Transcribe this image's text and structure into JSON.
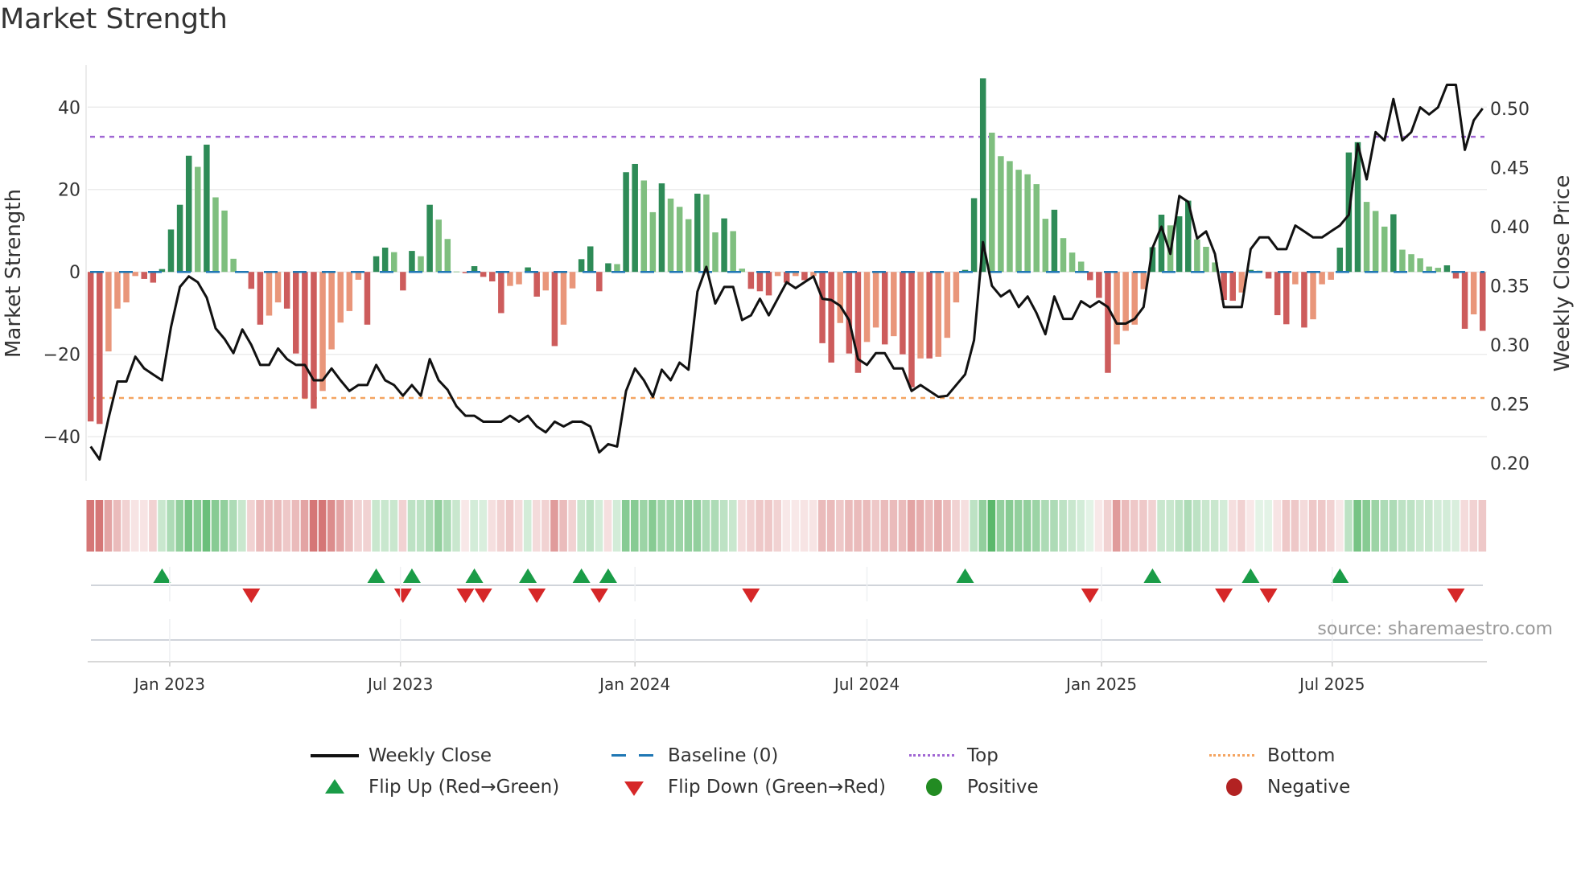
{
  "title": "Market Strength",
  "source": "source: sharemaestro.com",
  "legend": {
    "weekly_close": "Weekly Close",
    "baseline": "Baseline (0)",
    "top": "Top",
    "bottom": "Bottom",
    "flip_up": "Flip Up (Red→Green)",
    "flip_down": "Flip Down (Green→Red)",
    "positive": "Positive",
    "negative": "Negative"
  },
  "colors": {
    "pos_strong": "#2e8b57",
    "pos_weak": "#7fbf7f",
    "neg_strong": "#cd5c5c",
    "neg_weak": "#e9967a",
    "baseline": "#1f77b4",
    "top": "#a066d3",
    "bottom": "#f4a460",
    "line": "#111111",
    "flip_up": "#1a9c47",
    "flip_down": "#d62728",
    "positive": "#228b22",
    "negative": "#b22222"
  },
  "chart_data": {
    "type": "bar",
    "title": "Market Strength",
    "ylabel": "Market Strength",
    "ylabel_right": "Weekly Close Price",
    "frequency": "weekly",
    "start_date": "2022-10-31",
    "ylim": [
      -50.7,
      50.2
    ],
    "ylim_right": [
      0.185,
      0.5367
    ],
    "yticks": [
      40,
      20,
      0,
      -20,
      -40
    ],
    "yticks_labels": [
      "40",
      "20",
      "0",
      "−20",
      "−40"
    ],
    "yticks_right": [
      0.5,
      0.45,
      0.4,
      0.35,
      0.3,
      0.25,
      0.2
    ],
    "yticks_right_labels": [
      "0.50",
      "0.45",
      "0.40",
      "0.35",
      "0.30",
      "0.25",
      "0.20"
    ],
    "xticks": [
      {
        "date": "2023-01-01",
        "label": "Jan 2023"
      },
      {
        "date": "2023-07-01",
        "label": "Jul 2023"
      },
      {
        "date": "2024-01-01",
        "label": "Jan 2024"
      },
      {
        "date": "2024-07-01",
        "label": "Jul 2024"
      },
      {
        "date": "2025-01-01",
        "label": "Jan 2025"
      },
      {
        "date": "2025-07-01",
        "label": "Jul 2025"
      }
    ],
    "top_level": 32.8,
    "bottom_level": -30.6,
    "baseline": 0,
    "strength": [
      -36.3,
      -36.9,
      -19.3,
      -8.9,
      -7.4,
      -1,
      -1.7,
      -2.6,
      0.7,
      10.3,
      16.3,
      28.2,
      25.5,
      30.9,
      18.1,
      14.9,
      3.2,
      0.2,
      -4.1,
      -12.8,
      -10.6,
      -7.4,
      -8.9,
      -19.8,
      -30.7,
      -33.2,
      -28.9,
      -18.8,
      -12.3,
      -9.5,
      -1.9,
      -12.8,
      3.8,
      5.9,
      4.8,
      -4.5,
      5.1,
      3.8,
      16.3,
      12.7,
      8,
      0.1,
      -0.3,
      1.4,
      -1.2,
      -2.3,
      -10,
      -3.4,
      -3,
      1.1,
      -6,
      -4.5,
      -18,
      -12.8,
      -4,
      3.1,
      6.2,
      -4.7,
      2.1,
      1.9,
      24.2,
      26.2,
      22.2,
      14.5,
      21.5,
      17.8,
      15.8,
      12.8,
      19,
      18.8,
      9.6,
      13,
      9.9,
      0.8,
      -4.1,
      -4.7,
      -5.7,
      -1,
      -2.6,
      -1,
      -2,
      -1,
      -17.3,
      -22,
      -12.4,
      -19.8,
      -24.5,
      -17,
      -13.5,
      -17.6,
      -15.6,
      -20,
      -28,
      -21,
      -21,
      -20.6,
      -16,
      -7.4,
      0.5,
      17.9,
      47,
      33.8,
      28.1,
      26.9,
      24.8,
      23.7,
      21.3,
      12.9,
      15.1,
      8.2,
      4.7,
      2.5,
      -2,
      -6.3,
      -24.5,
      -17.6,
      -14.3,
      -12.8,
      -4.2,
      6,
      13.9,
      11.3,
      13.5,
      17.3,
      7.9,
      6.1,
      2.3,
      -6.8,
      -7,
      -5,
      0.5,
      0.3,
      -1.6,
      -10.5,
      -12.7,
      -3,
      -13.5,
      -11.5,
      -3,
      -1.9,
      5.9,
      29,
      31.5,
      17,
      14.8,
      11,
      14,
      5.4,
      4.3,
      3.3,
      1.3,
      1,
      1.6,
      -1.6,
      -13.8,
      -10.3,
      -14.3
    ],
    "weekly_close": [
      0.214,
      0.203,
      0.238,
      0.269,
      0.269,
      0.29,
      0.28,
      0.275,
      0.27,
      0.315,
      0.349,
      0.358,
      0.353,
      0.34,
      0.314,
      0.305,
      0.293,
      0.313,
      0.3,
      0.283,
      0.283,
      0.297,
      0.288,
      0.283,
      0.283,
      0.27,
      0.27,
      0.28,
      0.27,
      0.261,
      0.266,
      0.266,
      0.283,
      0.27,
      0.266,
      0.257,
      0.266,
      0.257,
      0.288,
      0.27,
      0.262,
      0.248,
      0.24,
      0.24,
      0.235,
      0.235,
      0.235,
      0.24,
      0.235,
      0.24,
      0.231,
      0.226,
      0.235,
      0.231,
      0.235,
      0.235,
      0.231,
      0.209,
      0.216,
      0.214,
      0.261,
      0.28,
      0.27,
      0.256,
      0.279,
      0.27,
      0.285,
      0.279,
      0.345,
      0.366,
      0.335,
      0.349,
      0.349,
      0.321,
      0.325,
      0.339,
      0.325,
      0.339,
      0.353,
      0.348,
      0.353,
      0.358,
      0.339,
      0.338,
      0.333,
      0.321,
      0.288,
      0.283,
      0.293,
      0.293,
      0.28,
      0.28,
      0.261,
      0.266,
      0.261,
      0.256,
      0.257,
      0.266,
      0.275,
      0.304,
      0.387,
      0.35,
      0.341,
      0.346,
      0.332,
      0.341,
      0.327,
      0.309,
      0.341,
      0.322,
      0.322,
      0.337,
      0.332,
      0.337,
      0.332,
      0.318,
      0.318,
      0.322,
      0.332,
      0.382,
      0.4,
      0.377,
      0.426,
      0.421,
      0.39,
      0.396,
      0.377,
      0.332,
      0.332,
      0.332,
      0.381,
      0.391,
      0.391,
      0.381,
      0.381,
      0.401,
      0.396,
      0.391,
      0.391,
      0.396,
      0.401,
      0.41,
      0.47,
      0.44,
      0.48,
      0.473,
      0.508,
      0.473,
      0.48,
      0.501,
      0.495,
      0.501,
      0.52,
      0.52,
      0.465,
      0.49,
      0.5
    ],
    "regime_strip": [
      -3,
      -3,
      -2,
      -1.5,
      -1,
      -0.6,
      -0.6,
      -1,
      1,
      1.5,
      2,
      2.5,
      2.2,
      2.7,
      2.2,
      2,
      1.5,
      1,
      -1,
      -1.5,
      -1.5,
      -1.5,
      -1.2,
      -1.5,
      -2,
      -3,
      -3,
      -2.5,
      -2,
      -1.5,
      -1,
      -1,
      1,
      1,
      1,
      -1,
      1.2,
      1.2,
      1.5,
      2,
      1.5,
      1,
      -0.5,
      0.8,
      0.7,
      -0.7,
      -1,
      -1.2,
      -0.8,
      0.8,
      -0.8,
      -1,
      -2.2,
      -1.5,
      -1,
      1,
      1.2,
      0.8,
      -0.7,
      0.8,
      2.2,
      2.2,
      1.8,
      2.2,
      1.8,
      1.8,
      1.8,
      2,
      2,
      1.5,
      1.5,
      1.2,
      1,
      -0.8,
      -1,
      -1.2,
      -1.2,
      -1,
      -0.5,
      -0.5,
      -0.6,
      -0.6,
      -1.5,
      -1.5,
      -1.2,
      -1.5,
      -1.5,
      -1.5,
      -1.2,
      -1.5,
      -1.5,
      -1.5,
      -2,
      -1.8,
      -1.5,
      -1.8,
      -1.5,
      -1,
      -0.7,
      1.2,
      2,
      3,
      2,
      2.2,
      2,
      2,
      1.8,
      1.5,
      1.5,
      1.2,
      1,
      0.8,
      0.5,
      -0.5,
      -1,
      -2.2,
      -1.5,
      -1.2,
      -1.2,
      -1,
      1,
      1,
      1.2,
      1.5,
      1.2,
      1,
      1,
      0.8,
      -0.7,
      -1,
      -0.5,
      0.5,
      0.5,
      -0.6,
      -1.2,
      -1.2,
      -0.8,
      -1.2,
      -1.2,
      -1,
      -0.5,
      1.2,
      2.5,
      2.2,
      1.8,
      1.5,
      1.5,
      1.2,
      1.2,
      1,
      1,
      0.8,
      0.8,
      0.7,
      -0.8,
      -1,
      -1.2
    ],
    "flip_up_weeks": [
      8,
      32,
      36,
      43,
      49,
      55,
      58,
      98,
      119,
      130,
      140
    ],
    "flip_down_weeks": [
      18,
      35,
      42,
      44,
      50,
      57,
      74,
      112,
      127,
      132,
      153
    ],
    "grid": true,
    "legend_position": "bottom-center"
  }
}
